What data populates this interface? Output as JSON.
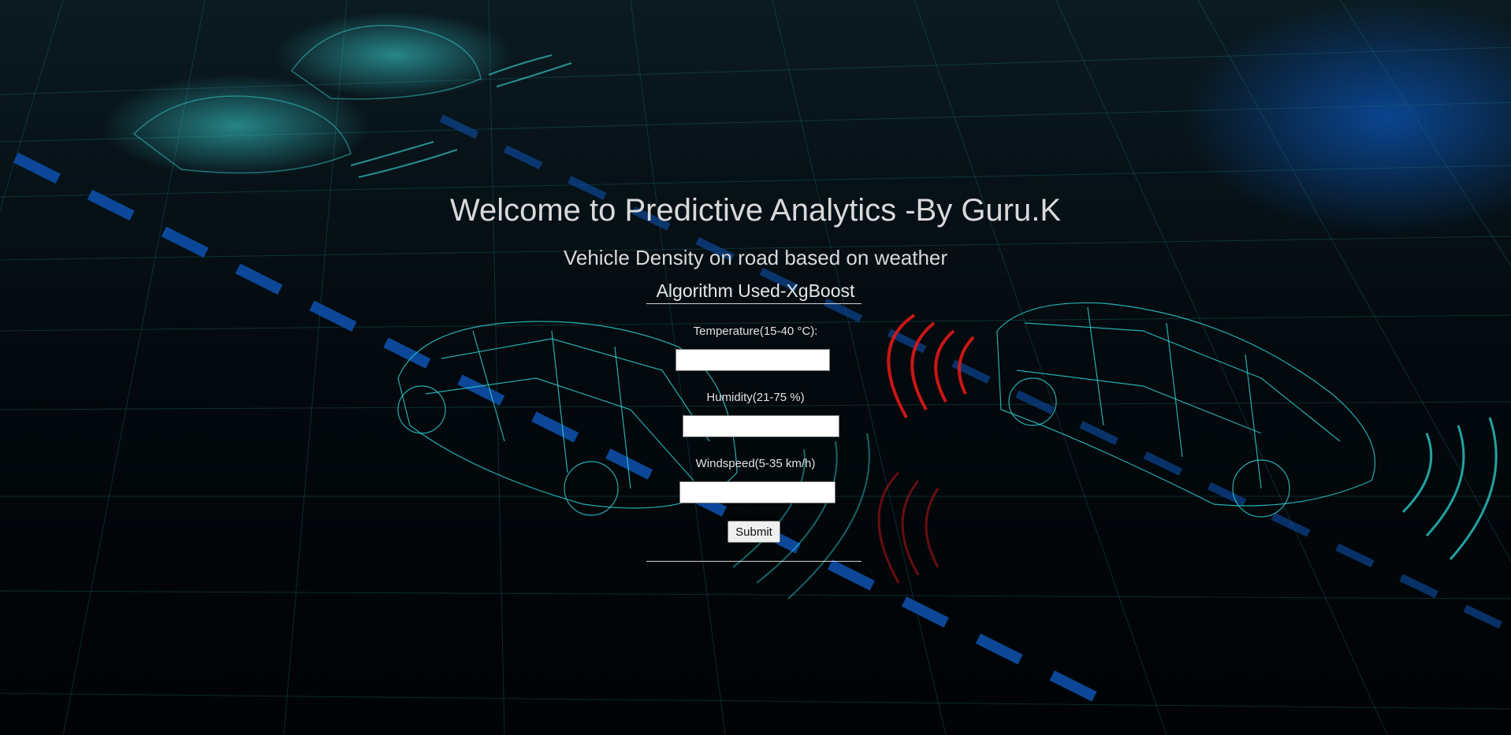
{
  "header": {
    "title": "Welcome to Predictive Analytics -By Guru.K",
    "subtitle": "Vehicle Density on road based on weather",
    "algorithm": "Algorithm Used-XgBoost"
  },
  "form": {
    "temperature_label": "Temperature(15-40 °C):",
    "temperature_value": "",
    "humidity_label": "Humidity(21-75 %)",
    "humidity_value": "",
    "windspeed_label": "Windspeed(5-35 km/h)",
    "windspeed_value": "",
    "submit_label": "Submit"
  },
  "colors": {
    "background": "#02070b",
    "wireframe": "#2fd6d6",
    "sensor_red": "#e01818",
    "road_marking": "#0d4fa8",
    "text": "#d9d9d9"
  }
}
